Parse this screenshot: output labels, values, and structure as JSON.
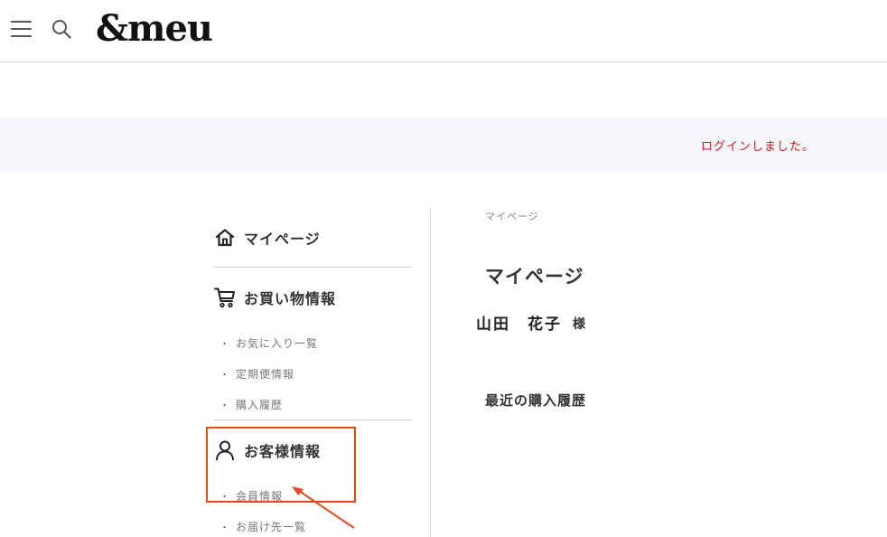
{
  "header": {
    "logo": "&meu",
    "menu_icon": "hamburger-menu-icon",
    "search_icon": "search-icon"
  },
  "notice": {
    "message": "ログインしました。",
    "color": "#c9171e"
  },
  "sidebar": {
    "mypage": {
      "label": "マイページ",
      "icon": "home-icon"
    },
    "purchase": {
      "label": "お買い物情報",
      "icon": "cart-icon",
      "items": [
        "お気に入り一覧",
        "定期便情報",
        "購入履歴"
      ]
    },
    "customer": {
      "label": "お客様情報",
      "icon": "user-icon",
      "items": [
        "会員情報",
        "お届け先一覧"
      ]
    }
  },
  "main": {
    "breadcrumb": "マイページ",
    "title": "マイページ",
    "user_name": "山田　花子",
    "user_suffix": "様",
    "history_title": "最近の購入履歴"
  },
  "annotation": {
    "color": "#e24a22"
  }
}
